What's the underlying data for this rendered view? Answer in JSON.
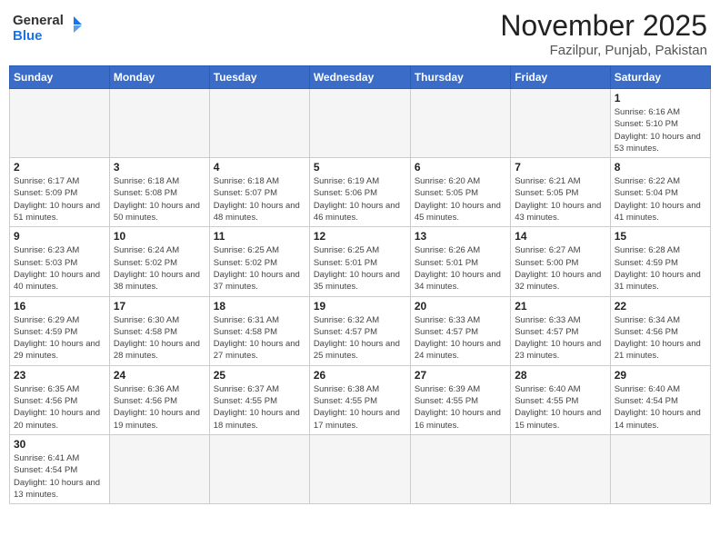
{
  "header": {
    "logo_general": "General",
    "logo_blue": "Blue",
    "month_title": "November 2025",
    "location": "Fazilpur, Punjab, Pakistan"
  },
  "weekdays": [
    "Sunday",
    "Monday",
    "Tuesday",
    "Wednesday",
    "Thursday",
    "Friday",
    "Saturday"
  ],
  "days": [
    {
      "num": "",
      "info": ""
    },
    {
      "num": "",
      "info": ""
    },
    {
      "num": "",
      "info": ""
    },
    {
      "num": "",
      "info": ""
    },
    {
      "num": "",
      "info": ""
    },
    {
      "num": "",
      "info": ""
    },
    {
      "num": "1",
      "info": "Sunrise: 6:16 AM\nSunset: 5:10 PM\nDaylight: 10 hours and 53 minutes."
    },
    {
      "num": "2",
      "info": "Sunrise: 6:17 AM\nSunset: 5:09 PM\nDaylight: 10 hours and 51 minutes."
    },
    {
      "num": "3",
      "info": "Sunrise: 6:18 AM\nSunset: 5:08 PM\nDaylight: 10 hours and 50 minutes."
    },
    {
      "num": "4",
      "info": "Sunrise: 6:18 AM\nSunset: 5:07 PM\nDaylight: 10 hours and 48 minutes."
    },
    {
      "num": "5",
      "info": "Sunrise: 6:19 AM\nSunset: 5:06 PM\nDaylight: 10 hours and 46 minutes."
    },
    {
      "num": "6",
      "info": "Sunrise: 6:20 AM\nSunset: 5:05 PM\nDaylight: 10 hours and 45 minutes."
    },
    {
      "num": "7",
      "info": "Sunrise: 6:21 AM\nSunset: 5:05 PM\nDaylight: 10 hours and 43 minutes."
    },
    {
      "num": "8",
      "info": "Sunrise: 6:22 AM\nSunset: 5:04 PM\nDaylight: 10 hours and 41 minutes."
    },
    {
      "num": "9",
      "info": "Sunrise: 6:23 AM\nSunset: 5:03 PM\nDaylight: 10 hours and 40 minutes."
    },
    {
      "num": "10",
      "info": "Sunrise: 6:24 AM\nSunset: 5:02 PM\nDaylight: 10 hours and 38 minutes."
    },
    {
      "num": "11",
      "info": "Sunrise: 6:25 AM\nSunset: 5:02 PM\nDaylight: 10 hours and 37 minutes."
    },
    {
      "num": "12",
      "info": "Sunrise: 6:25 AM\nSunset: 5:01 PM\nDaylight: 10 hours and 35 minutes."
    },
    {
      "num": "13",
      "info": "Sunrise: 6:26 AM\nSunset: 5:01 PM\nDaylight: 10 hours and 34 minutes."
    },
    {
      "num": "14",
      "info": "Sunrise: 6:27 AM\nSunset: 5:00 PM\nDaylight: 10 hours and 32 minutes."
    },
    {
      "num": "15",
      "info": "Sunrise: 6:28 AM\nSunset: 4:59 PM\nDaylight: 10 hours and 31 minutes."
    },
    {
      "num": "16",
      "info": "Sunrise: 6:29 AM\nSunset: 4:59 PM\nDaylight: 10 hours and 29 minutes."
    },
    {
      "num": "17",
      "info": "Sunrise: 6:30 AM\nSunset: 4:58 PM\nDaylight: 10 hours and 28 minutes."
    },
    {
      "num": "18",
      "info": "Sunrise: 6:31 AM\nSunset: 4:58 PM\nDaylight: 10 hours and 27 minutes."
    },
    {
      "num": "19",
      "info": "Sunrise: 6:32 AM\nSunset: 4:57 PM\nDaylight: 10 hours and 25 minutes."
    },
    {
      "num": "20",
      "info": "Sunrise: 6:33 AM\nSunset: 4:57 PM\nDaylight: 10 hours and 24 minutes."
    },
    {
      "num": "21",
      "info": "Sunrise: 6:33 AM\nSunset: 4:57 PM\nDaylight: 10 hours and 23 minutes."
    },
    {
      "num": "22",
      "info": "Sunrise: 6:34 AM\nSunset: 4:56 PM\nDaylight: 10 hours and 21 minutes."
    },
    {
      "num": "23",
      "info": "Sunrise: 6:35 AM\nSunset: 4:56 PM\nDaylight: 10 hours and 20 minutes."
    },
    {
      "num": "24",
      "info": "Sunrise: 6:36 AM\nSunset: 4:56 PM\nDaylight: 10 hours and 19 minutes."
    },
    {
      "num": "25",
      "info": "Sunrise: 6:37 AM\nSunset: 4:55 PM\nDaylight: 10 hours and 18 minutes."
    },
    {
      "num": "26",
      "info": "Sunrise: 6:38 AM\nSunset: 4:55 PM\nDaylight: 10 hours and 17 minutes."
    },
    {
      "num": "27",
      "info": "Sunrise: 6:39 AM\nSunset: 4:55 PM\nDaylight: 10 hours and 16 minutes."
    },
    {
      "num": "28",
      "info": "Sunrise: 6:40 AM\nSunset: 4:55 PM\nDaylight: 10 hours and 15 minutes."
    },
    {
      "num": "29",
      "info": "Sunrise: 6:40 AM\nSunset: 4:54 PM\nDaylight: 10 hours and 14 minutes."
    },
    {
      "num": "30",
      "info": "Sunrise: 6:41 AM\nSunset: 4:54 PM\nDaylight: 10 hours and 13 minutes."
    },
    {
      "num": "",
      "info": ""
    },
    {
      "num": "",
      "info": ""
    },
    {
      "num": "",
      "info": ""
    },
    {
      "num": "",
      "info": ""
    },
    {
      "num": "",
      "info": ""
    },
    {
      "num": "",
      "info": ""
    }
  ]
}
